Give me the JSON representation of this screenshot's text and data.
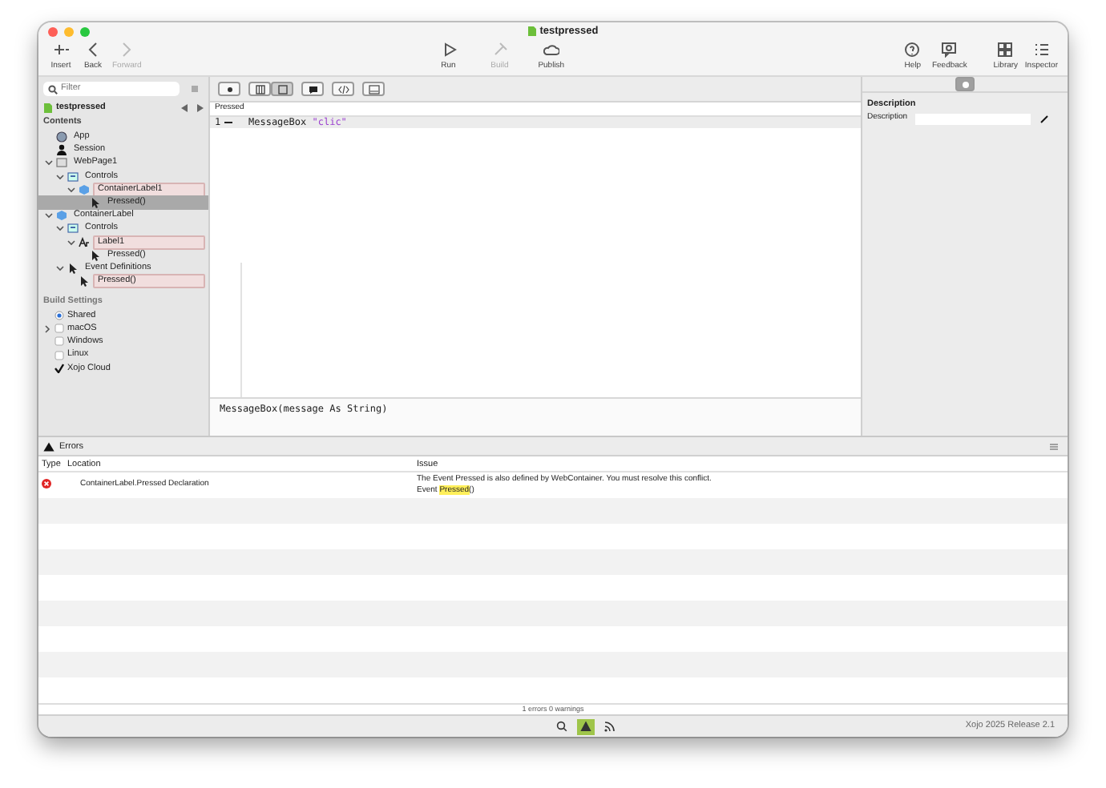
{
  "window": {
    "title": "testpressed"
  },
  "toolbar": {
    "left": [
      {
        "kind": "insert",
        "label": "Insert",
        "disabled": false
      },
      {
        "kind": "back",
        "label": "Back",
        "disabled": false
      },
      {
        "kind": "forward",
        "label": "Forward",
        "disabled": true
      }
    ],
    "center": [
      {
        "kind": "run",
        "label": "Run",
        "disabled": false
      },
      {
        "kind": "build",
        "label": "Build",
        "disabled": true
      },
      {
        "kind": "publish",
        "label": "Publish",
        "disabled": false
      }
    ],
    "right": [
      {
        "kind": "help",
        "label": "Help"
      },
      {
        "kind": "feedback",
        "label": "Feedback"
      },
      {
        "kind": "library",
        "label": "Library"
      },
      {
        "kind": "inspector",
        "label": "Inspector"
      }
    ]
  },
  "navigator": {
    "filter_placeholder": "Filter",
    "project": "testpressed",
    "contents_heading": "Contents",
    "tree": [
      {
        "label": "App",
        "kind": "app",
        "highlighted": false,
        "selected": false
      },
      {
        "label": "Session",
        "kind": "session",
        "highlighted": false,
        "selected": false
      },
      {
        "label": "WebPage1",
        "kind": "page",
        "highlighted": false,
        "selected": false,
        "expanded": true,
        "children": [
          {
            "label": "Controls",
            "kind": "controls",
            "highlighted": false,
            "selected": false,
            "expanded": true,
            "children": [
              {
                "label": "ContainerLabel1",
                "kind": "container",
                "highlighted": true,
                "selected": false,
                "expanded": true,
                "children": [
                  {
                    "label": "Pressed()",
                    "kind": "event",
                    "highlighted": false,
                    "selected": true
                  }
                ]
              }
            ]
          }
        ]
      },
      {
        "label": "ContainerLabel",
        "kind": "container",
        "highlighted": false,
        "selected": false,
        "expanded": true,
        "children": [
          {
            "label": "Controls",
            "kind": "controls",
            "highlighted": false,
            "selected": false,
            "expanded": true,
            "children": [
              {
                "label": "Label1",
                "kind": "label",
                "highlighted": true,
                "selected": false,
                "expanded": true,
                "children": [
                  {
                    "label": "Pressed()",
                    "kind": "event",
                    "highlighted": false,
                    "selected": false
                  }
                ]
              }
            ]
          },
          {
            "label": "Event Definitions",
            "kind": "event",
            "highlighted": false,
            "selected": false,
            "expanded": true,
            "children": [
              {
                "label": "Pressed()",
                "kind": "event",
                "highlighted": true,
                "selected": false
              }
            ]
          }
        ]
      }
    ],
    "build_heading": "Build Settings",
    "build": [
      {
        "kind": "radio",
        "label": "Shared",
        "checked": true,
        "expandable": false
      },
      {
        "kind": "checkbox",
        "label": "macOS",
        "checked": false,
        "expandable": true
      },
      {
        "kind": "checkbox",
        "label": "Windows",
        "checked": false,
        "expandable": false
      },
      {
        "kind": "checkbox",
        "label": "Linux",
        "checked": false,
        "expandable": false
      },
      {
        "kind": "checkmark",
        "label": "Xojo Cloud",
        "checked": true,
        "expandable": false
      }
    ]
  },
  "editor": {
    "view_modes": [
      {
        "selected": false
      },
      {
        "selected": true
      }
    ],
    "method": "Pressed",
    "lines": [
      {
        "number": "1",
        "parts": [
          {
            "kind": "plain",
            "text": "MessageBox "
          },
          {
            "kind": "string",
            "text": "\"clic\""
          }
        ]
      }
    ],
    "signature": "MessageBox(message As String)"
  },
  "inspector": {
    "section": "Description",
    "fields": [
      {
        "label": "Description"
      }
    ]
  },
  "errors": {
    "title": "Errors",
    "columns": [
      "Type",
      "Location",
      "Issue"
    ],
    "rows": [
      {
        "kind": "error",
        "location": "ContainerLabel.Pressed Declaration",
        "issue": "The Event Pressed is also defined by WebContainer.  You must resolve this conflict.",
        "detail": "Event ",
        "detail_highlight": "Pressed",
        "detail_suffix": "()"
      }
    ],
    "summary": "1 errors 0 warnings"
  },
  "status_bar": {
    "buttons": [
      {
        "kind": "search",
        "selected": false
      },
      {
        "kind": "warning",
        "selected": true
      },
      {
        "kind": "feed",
        "selected": false
      }
    ],
    "version": "Xojo 2025 Release 2.1"
  }
}
